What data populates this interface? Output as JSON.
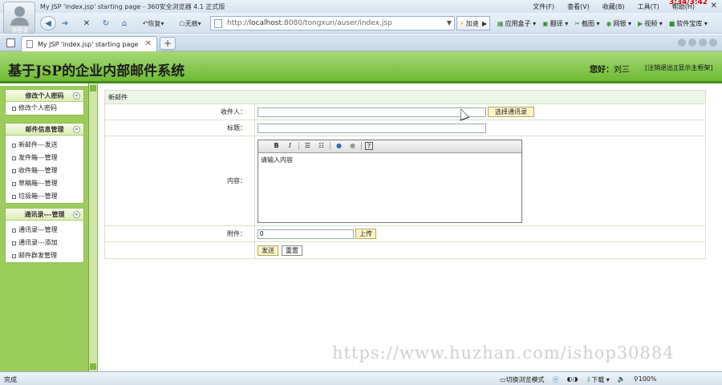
{
  "window": {
    "title": "My JSP 'index.jsp' starting page - 360安全浏览器 4.1 正式版",
    "avatar_label": "请登录",
    "menu": [
      "文件(F)",
      "查看(V)",
      "收藏(B)",
      "工具(T)",
      "帮助(H)"
    ],
    "clock": "3:34/3:42"
  },
  "toolbar": {
    "restore_label": "恢复",
    "noimg_label": "无痕",
    "address_prefix": "http://",
    "address_host": "localhost",
    "address_rest": ":8080/tongxun/auser/index.jsp",
    "speed_label": "加速",
    "right_items": [
      "应用盒子",
      "翻译",
      "截图",
      "网银",
      "视频",
      "软件宝库"
    ]
  },
  "tabs": [
    {
      "label": "My JSP 'index.jsp' starting page"
    }
  ],
  "header": {
    "app_title": "基于JSP的企业内部邮件系统",
    "greeting": "您好：",
    "username": "刘三",
    "logout_link": "[注销退出]",
    "home_link": "[显示主框架]"
  },
  "sidebar": {
    "panels": [
      {
        "title": "修改个人密码",
        "items": [
          "修改个人密码"
        ]
      },
      {
        "title": "邮件信息管理",
        "items": [
          "新邮件---发送",
          "发件箱---管理",
          "收件箱---管理",
          "草稿箱---管理",
          "垃圾箱---管理"
        ]
      },
      {
        "title": "通讯录---管理",
        "items": [
          "通讯录---管理",
          "通讯录---添加",
          "邮件群发管理"
        ]
      }
    ],
    "toggle_glyph": "«"
  },
  "form": {
    "heading": "新邮件",
    "recipient_label": "收件人：",
    "recipient_value": "",
    "select_contacts_button": "选择通讯录",
    "subject_label": "标题：",
    "subject_value": "",
    "content_label": "内容：",
    "content_value": "请输入内容",
    "attachment_label": "附件：",
    "attachment_value": "0",
    "upload_button": "上传",
    "send_button": "发送",
    "reset_button": "重置"
  },
  "editor_toolbar": {
    "bold": "B",
    "italic": "I",
    "help": "?"
  },
  "watermark": "https://www.huzhan.com/ishop30884",
  "statusbar": {
    "left": "完成",
    "right_items": [
      "切换浏览模式",
      "下载",
      "100%"
    ]
  },
  "colors": {
    "header_green": "#6fba35",
    "sidebar_green": "#9ccc5c",
    "button_yellow": "#fbf6c9"
  }
}
